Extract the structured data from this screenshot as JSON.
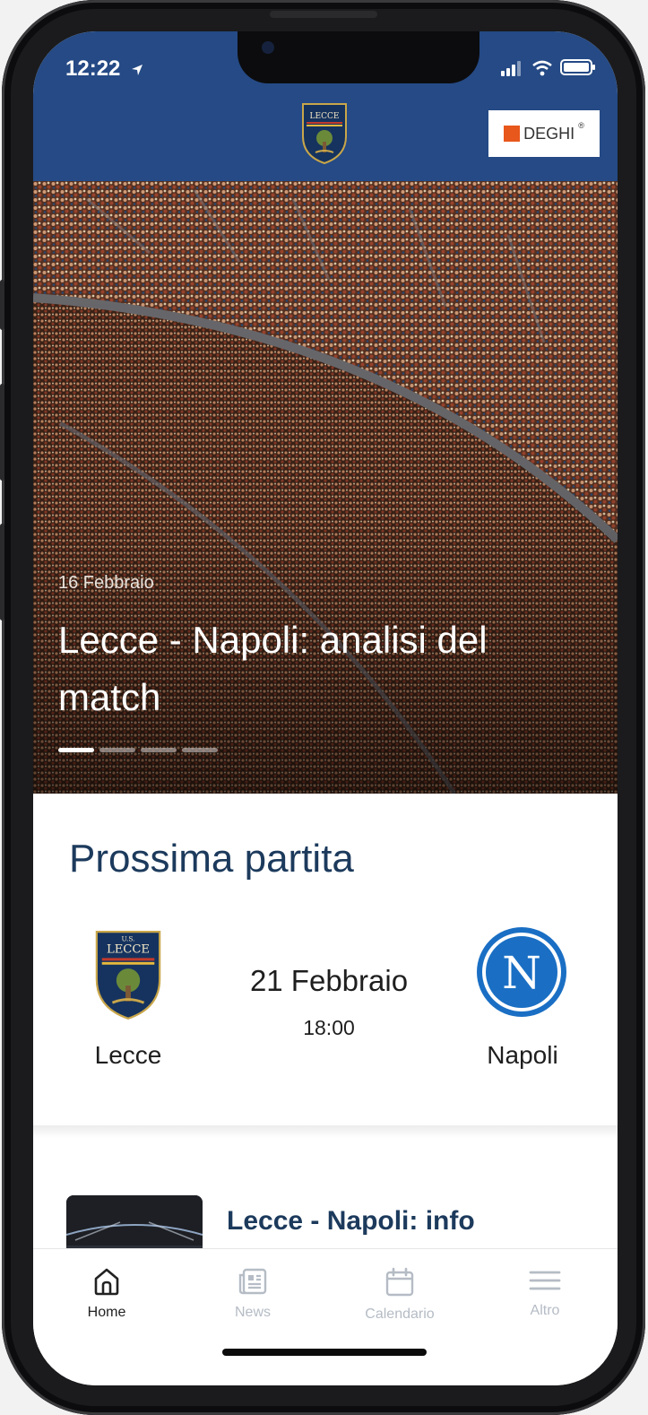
{
  "status_bar": {
    "time": "12:22"
  },
  "header": {
    "crest_text": "LECCE",
    "crest_top_text": "U.S.",
    "sponsor_name": "DEGHI",
    "sponsor_mark": "®"
  },
  "hero": {
    "date": "16 Febbraio",
    "title": "Lecce - Napoli: analisi del match",
    "slides_total": 4,
    "active_slide": 1
  },
  "next_match": {
    "heading": "Prossima partita",
    "home_team": "Lecce",
    "away_team": "Napoli",
    "away_crest_letter": "N",
    "date": "21 Febbraio",
    "time": "18:00"
  },
  "news": {
    "first_title": "Lecce - Napoli: info"
  },
  "tab_bar": {
    "items": [
      {
        "label": "Home",
        "icon": "home-icon",
        "active": true
      },
      {
        "label": "News",
        "icon": "news-icon",
        "active": false
      },
      {
        "label": "Calendario",
        "icon": "calendar-icon",
        "active": false
      },
      {
        "label": "Altro",
        "icon": "menu-icon",
        "active": false
      }
    ]
  },
  "colors": {
    "header_blue": "#254a85",
    "title_navy": "#1c3a5c",
    "napoli_blue": "#1a6fc4",
    "sponsor_orange": "#e8571c",
    "tab_inactive": "#b5bcc5"
  }
}
